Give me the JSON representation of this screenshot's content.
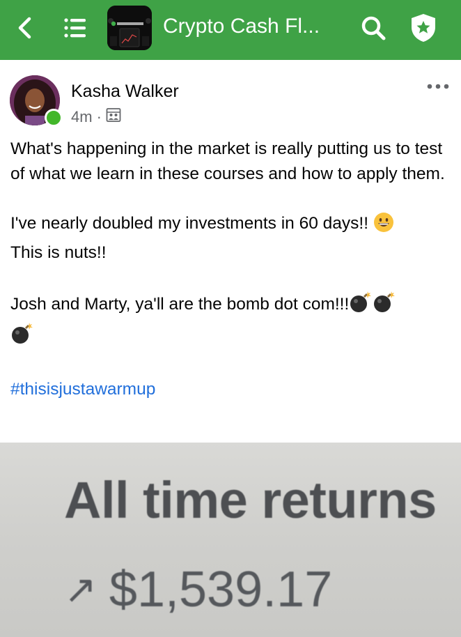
{
  "header": {
    "group_title": "Crypto Cash Fl...",
    "group_thumb_text": "CryptoCashFlow"
  },
  "post": {
    "author": "Kasha Walker",
    "time": "4m",
    "separator": "·",
    "paragraph1": "What's happening in the market is really putting us to test of what we learn in these courses and how to apply them.",
    "paragraph2": "I've nearly doubled my investments in 60 days!!",
    "paragraph2b": "This is nuts!!",
    "paragraph3": "Josh and Marty, ya'll are the bomb dot com!!!",
    "hashtag": "#thisisjustawarmup"
  },
  "photo": {
    "heading": "All time returns",
    "arrow": "↗",
    "amount": "$1,539.17"
  },
  "colors": {
    "topbar": "#3fa246",
    "online": "#42b72a",
    "hashtag": "#216fdb"
  }
}
